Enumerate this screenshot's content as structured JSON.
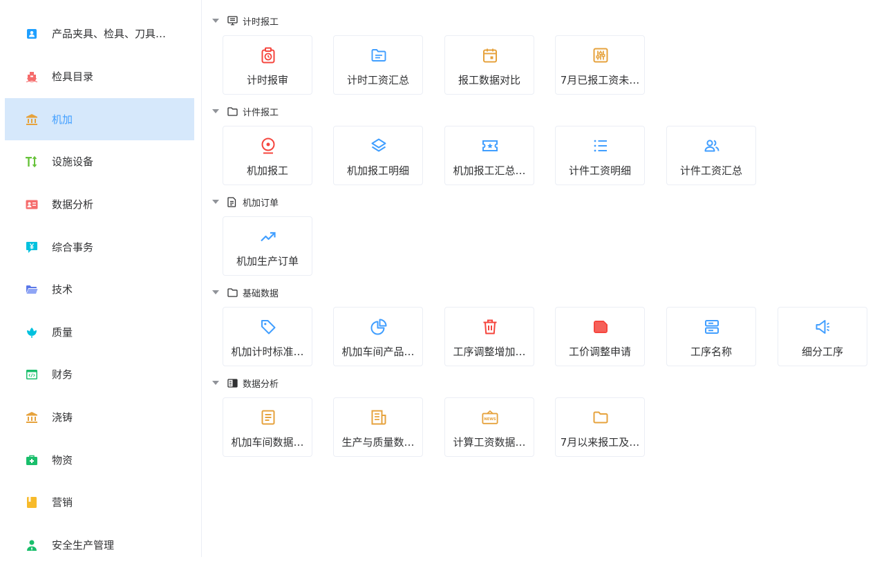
{
  "sidebar": {
    "items": [
      {
        "label": "产品夹具、检具、刀具…",
        "icon": "id-card-icon",
        "color": "#1e9fff"
      },
      {
        "label": "检具目录",
        "icon": "ship-icon",
        "color": "#f56c6c"
      },
      {
        "label": "机加",
        "icon": "bank-icon",
        "color": "#e6a23c"
      },
      {
        "label": "设施设备",
        "icon": "text-size-icon",
        "color": "#67c23a"
      },
      {
        "label": "数据分析",
        "icon": "id-badge-icon",
        "color": "#f56c6c"
      },
      {
        "label": "综合事务",
        "icon": "yen-message-icon",
        "color": "#00c1de"
      },
      {
        "label": "技术",
        "icon": "folder-open-icon",
        "color": "#5a78e8"
      },
      {
        "label": "质量",
        "icon": "lotus-icon",
        "color": "#00c1de"
      },
      {
        "label": "财务",
        "icon": "code-window-icon",
        "color": "#19be6b"
      },
      {
        "label": "浇铸",
        "icon": "bank-icon",
        "color": "#e6a23c"
      },
      {
        "label": "物资",
        "icon": "medical-kit-icon",
        "color": "#19be6b"
      },
      {
        "label": "营销",
        "icon": "book-icon",
        "color": "#f7ba2a"
      },
      {
        "label": "安全生产管理",
        "icon": "user-icon",
        "color": "#19be6b"
      }
    ]
  },
  "groups": [
    {
      "title": "计时报工",
      "icon": "monitor-icon",
      "cards": [
        {
          "label": "计时报审",
          "icon": "alarm-clipboard-icon",
          "color": "#f5453d"
        },
        {
          "label": "计时工资汇总",
          "icon": "folder-doc-icon",
          "color": "#409eff"
        },
        {
          "label": "报工数据对比",
          "icon": "calendar-icon",
          "color": "#e6a23c"
        },
        {
          "label": "7月已报工资未…",
          "icon": "sliders-icon",
          "color": "#e6a23c"
        }
      ]
    },
    {
      "title": "计件报工",
      "icon": "folder-icon",
      "cards": [
        {
          "label": "机加报工",
          "icon": "location-pin-icon",
          "color": "#f5453d"
        },
        {
          "label": "机加报工明细",
          "icon": "layers-icon",
          "color": "#409eff"
        },
        {
          "label": "机加报工汇总…",
          "icon": "ticket-icon",
          "color": "#409eff"
        },
        {
          "label": "计件工资明细",
          "icon": "list-icon",
          "color": "#409eff"
        },
        {
          "label": "计件工资汇总",
          "icon": "users-icon",
          "color": "#409eff"
        }
      ]
    },
    {
      "title": "机加订单",
      "icon": "document-icon",
      "cards": [
        {
          "label": "机加生产订单",
          "icon": "trend-up-icon",
          "color": "#409eff"
        }
      ]
    },
    {
      "title": "基础数据",
      "icon": "folder-icon",
      "cards": [
        {
          "label": "机加计时标准…",
          "icon": "tag-icon",
          "color": "#409eff"
        },
        {
          "label": "机加车间产品…",
          "icon": "pie-chart-icon",
          "color": "#409eff"
        },
        {
          "label": "工序调整增加…",
          "icon": "trash-icon",
          "color": "#f5453d"
        },
        {
          "label": "工价调整申请",
          "icon": "note-icon",
          "color": "#f5453d"
        },
        {
          "label": "工序名称",
          "icon": "server-icon",
          "color": "#409eff"
        },
        {
          "label": "细分工序",
          "icon": "megaphone-icon",
          "color": "#409eff"
        }
      ]
    },
    {
      "title": "数据分析",
      "icon": "sidebar-layout-icon",
      "cards": [
        {
          "label": "机加车间数据…",
          "icon": "article-icon",
          "color": "#e6a23c"
        },
        {
          "label": "生产与质量数…",
          "icon": "newspaper-icon",
          "color": "#e6a23c"
        },
        {
          "label": "计算工资数据…",
          "icon": "news-sign-icon",
          "color": "#e6a23c"
        },
        {
          "label": "7月以来报工及…",
          "icon": "folder-icon",
          "color": "#e6a23c"
        }
      ]
    }
  ],
  "news_badge_text": "NEWS"
}
